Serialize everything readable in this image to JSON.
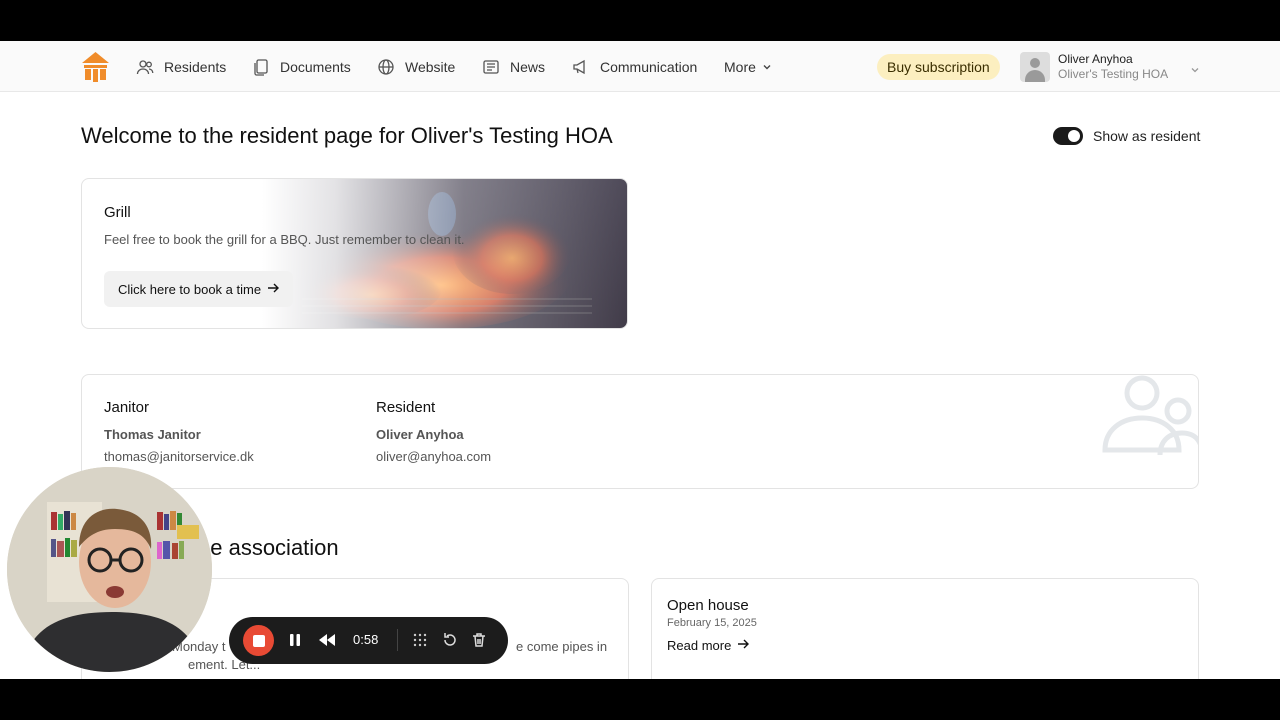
{
  "nav": {
    "items": [
      {
        "label": "Residents",
        "icon": "users-icon"
      },
      {
        "label": "Documents",
        "icon": "documents-icon"
      },
      {
        "label": "Website",
        "icon": "globe-icon"
      },
      {
        "label": "News",
        "icon": "newspaper-icon"
      },
      {
        "label": "Communication",
        "icon": "megaphone-icon"
      }
    ],
    "more_label": "More",
    "buy_label": "Buy subscription",
    "account": {
      "name": "Oliver Anyhoa",
      "org": "Oliver's Testing HOA"
    }
  },
  "header": {
    "title": "Welcome to the resident page for Oliver's Testing HOA",
    "toggle_label": "Show as resident",
    "toggle_on": true
  },
  "grill": {
    "title": "Grill",
    "description": "Feel free to book the grill for a BBQ. Just remember to clean it.",
    "button_label": "Click here to book a time"
  },
  "contacts": [
    {
      "role": "Janitor",
      "name": "Thomas Janitor",
      "email": "thomas@janitorservice.dk"
    },
    {
      "role": "Resident",
      "name": "Oliver Anyhoa",
      "email": "oliver@anyhoa.com"
    }
  ],
  "section": {
    "title_visible": "he association"
  },
  "news": {
    "left_snippet_line1": "Monday t",
    "left_snippet_line1_end": "e come pipes in",
    "left_snippet_line2": "ement. Let...",
    "right": {
      "title": "Open house",
      "date": "February 15, 2025",
      "read_more": "Read more"
    }
  },
  "recorder": {
    "time": "0:58"
  },
  "colors": {
    "accent": "#f08c2a",
    "buy_bg": "#fcefc0",
    "stop": "#e84a34"
  }
}
